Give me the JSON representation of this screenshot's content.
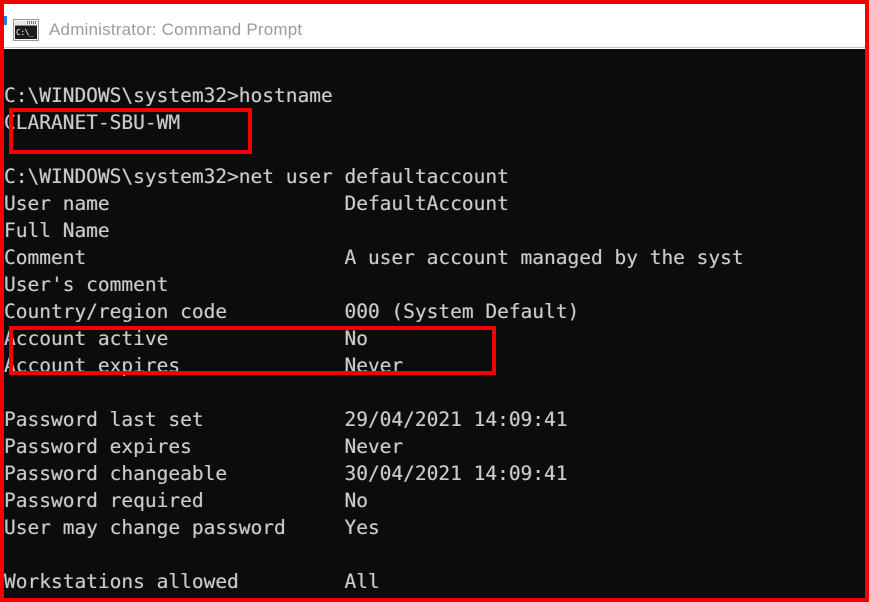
{
  "window": {
    "title": "Administrator: Command Prompt",
    "icon": "command-prompt-icon",
    "icon_glyph": "C:\\_",
    "clipped_top_fragment": "' '  ' ' ' '   ' '      ' '    ' '    ' '  ' '"
  },
  "colors": {
    "annotation_red": "#f40000",
    "console_background": "#0c0c0c",
    "console_text": "#cccccc",
    "titlebar_background": "#ffffff",
    "titlebar_text": "#9c9c9c"
  },
  "console": {
    "lines": [
      "",
      "C:\\WINDOWS\\system32>hostname",
      "CLARANET-SBU-WM",
      "",
      "C:\\WINDOWS\\system32>net user defaultaccount",
      "User name                    DefaultAccount",
      "Full Name",
      "Comment                      A user account managed by the syst",
      "User's comment",
      "Country/region code          000 (System Default)",
      "Account active               No",
      "Account expires              Never",
      "",
      "Password last set            29/04/2021 14:09:41",
      "Password expires             Never",
      "Password changeable          30/04/2021 14:09:41",
      "Password required            No",
      "User may change password     Yes",
      "",
      "Workstations allowed         All"
    ],
    "commands": [
      "hostname",
      "net user defaultaccount"
    ],
    "prompt": "C:\\WINDOWS\\system32>",
    "hostname_result": "CLARANET-SBU-WM",
    "net_user_fields": [
      {
        "label": "User name",
        "value": "DefaultAccount"
      },
      {
        "label": "Full Name",
        "value": ""
      },
      {
        "label": "Comment",
        "value": "A user account managed by the syst"
      },
      {
        "label": "User's comment",
        "value": ""
      },
      {
        "label": "Country/region code",
        "value": "000 (System Default)"
      },
      {
        "label": "Account active",
        "value": "No"
      },
      {
        "label": "Account expires",
        "value": "Never"
      },
      {
        "label": "Password last set",
        "value": "29/04/2021 14:09:41"
      },
      {
        "label": "Password expires",
        "value": "Never"
      },
      {
        "label": "Password changeable",
        "value": "30/04/2021 14:09:41"
      },
      {
        "label": "Password required",
        "value": "No"
      },
      {
        "label": "User may change password",
        "value": "Yes"
      },
      {
        "label": "Workstations allowed",
        "value": "All"
      }
    ]
  },
  "annotations": [
    {
      "name": "hostname-highlight",
      "target": "CLARANET-SBU-WM"
    },
    {
      "name": "account-active-highlight",
      "target": "Account active               No"
    }
  ]
}
